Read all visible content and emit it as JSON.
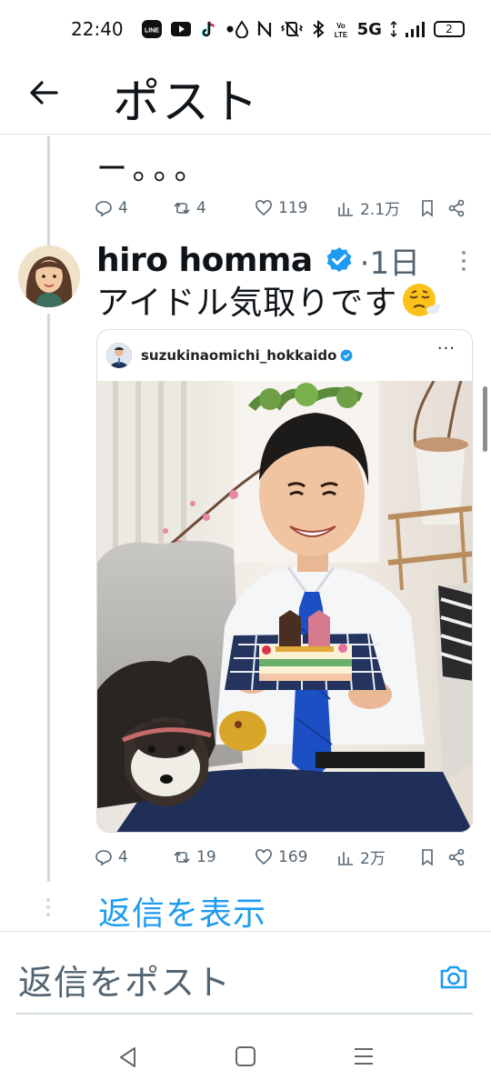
{
  "status_bar": {
    "time": "22:40",
    "left_icons": [
      "line-icon",
      "youtube-icon",
      "tiktok-icon",
      "dot-icon"
    ],
    "right_icons": [
      "data-saver-icon",
      "nfc-icon",
      "vibrate-icon",
      "bluetooth-icon",
      "volte-icon"
    ],
    "network": "5G",
    "battery": "2"
  },
  "app_bar": {
    "title": "ポスト"
  },
  "previous_post": {
    "text": "ー。。。",
    "actions": {
      "reply": "4",
      "repost": "4",
      "like": "119",
      "views": "2.1万"
    }
  },
  "post": {
    "user_name": "hiro homma",
    "time": "·1日",
    "text": "アイドル気取りです",
    "emoji": "tired-face-emoji",
    "embed": {
      "handle": "suzukinaomichi_hokkaido",
      "more": "···"
    },
    "actions": {
      "reply": "4",
      "repost": "19",
      "like": "169",
      "views": "2万"
    }
  },
  "show_replies": "返信を表示",
  "compose": {
    "placeholder": "返信をポスト"
  },
  "colors": {
    "accent": "#1d9bf0",
    "muted": "#536471"
  }
}
